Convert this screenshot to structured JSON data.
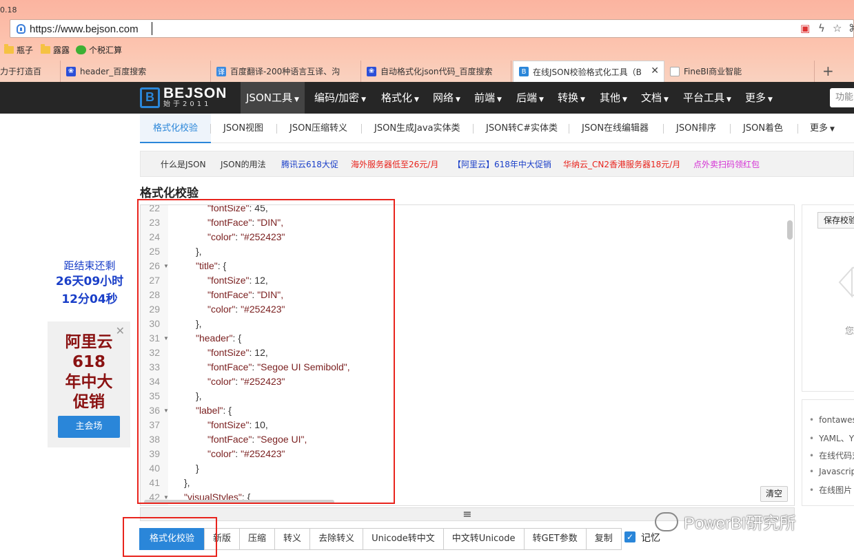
{
  "browser": {
    "version_fragment": "0.18",
    "url": "https://www.bejson.com",
    "bookmarks": [
      "瓶子",
      "露露",
      "个税汇算"
    ],
    "tabs": [
      {
        "label": "力于打造百",
        "active": false
      },
      {
        "label": "header_百度搜索",
        "active": false
      },
      {
        "label": "百度翻译-200种语言互译、沟",
        "active": false
      },
      {
        "label": "自动格式化json代码_百度搜索",
        "active": false
      },
      {
        "label": "在线JSON校验格式化工具（B",
        "active": true
      },
      {
        "label": "FineBI商业智能",
        "active": false
      }
    ],
    "tab_close": "✕",
    "new_tab": "+"
  },
  "site": {
    "logo_text": "BEJSON",
    "logo_sub": "始于2011",
    "logo_mark": "B",
    "nav": [
      {
        "label": "JSON工具",
        "active": true
      },
      {
        "label": "编码/加密"
      },
      {
        "label": "格式化"
      },
      {
        "label": "网络"
      },
      {
        "label": "前端"
      },
      {
        "label": "后端"
      },
      {
        "label": "转换"
      },
      {
        "label": "其他"
      },
      {
        "label": "文档"
      },
      {
        "label": "平台工具"
      },
      {
        "label": "更多"
      }
    ],
    "func_placeholder": "功能",
    "subnav": [
      "格式化校验",
      "JSON视图",
      "JSON压缩转义",
      "JSON生成Java实体类",
      "JSON转C#实体类",
      "JSON在线编辑器",
      "JSON排序",
      "JSON着色",
      "更多"
    ],
    "links": [
      {
        "label": "什么是JSON",
        "color": "#333333"
      },
      {
        "label": "JSON的用法",
        "color": "#333333"
      },
      {
        "label": "腾讯云618大促",
        "color": "#1a3fc8"
      },
      {
        "label": "海外服务器低至26元/月",
        "color": "#e8231c"
      },
      {
        "label": "【阿里云】618年中大促销",
        "color": "#1a3fc8"
      },
      {
        "label": "华纳云_CN2香港服务器18元/月",
        "color": "#e8231c"
      },
      {
        "label": "点外卖扫码领红包",
        "color": "#d42fd4"
      }
    ],
    "page_title": "格式化校验"
  },
  "editor": {
    "lines": [
      {
        "n": "22",
        "fold": false,
        "indent": 3,
        "key": "\"fontSize\"",
        "rest": ": 45,",
        "value": ""
      },
      {
        "n": "23",
        "fold": false,
        "indent": 3,
        "key": "\"fontFace\"",
        "rest": ": ",
        "value": "\"DIN\","
      },
      {
        "n": "24",
        "fold": false,
        "indent": 3,
        "key": "\"color\"",
        "rest": ": ",
        "value": "\"#252423\""
      },
      {
        "n": "25",
        "fold": false,
        "indent": 2,
        "key": "",
        "rest": "},",
        "value": ""
      },
      {
        "n": "26",
        "fold": true,
        "indent": 2,
        "key": "\"title\"",
        "rest": ": {",
        "value": ""
      },
      {
        "n": "27",
        "fold": false,
        "indent": 3,
        "key": "\"fontSize\"",
        "rest": ": 12,",
        "value": ""
      },
      {
        "n": "28",
        "fold": false,
        "indent": 3,
        "key": "\"fontFace\"",
        "rest": ": ",
        "value": "\"DIN\","
      },
      {
        "n": "29",
        "fold": false,
        "indent": 3,
        "key": "\"color\"",
        "rest": ": ",
        "value": "\"#252423\""
      },
      {
        "n": "30",
        "fold": false,
        "indent": 2,
        "key": "",
        "rest": "},",
        "value": ""
      },
      {
        "n": "31",
        "fold": true,
        "indent": 2,
        "key": "\"header\"",
        "rest": ": {",
        "value": ""
      },
      {
        "n": "32",
        "fold": false,
        "indent": 3,
        "key": "\"fontSize\"",
        "rest": ": 12,",
        "value": ""
      },
      {
        "n": "33",
        "fold": false,
        "indent": 3,
        "key": "\"fontFace\"",
        "rest": ": ",
        "value": "\"Segoe UI Semibold\","
      },
      {
        "n": "34",
        "fold": false,
        "indent": 3,
        "key": "\"color\"",
        "rest": ": ",
        "value": "\"#252423\""
      },
      {
        "n": "35",
        "fold": false,
        "indent": 2,
        "key": "",
        "rest": "},",
        "value": ""
      },
      {
        "n": "36",
        "fold": true,
        "indent": 2,
        "key": "\"label\"",
        "rest": ": {",
        "value": ""
      },
      {
        "n": "37",
        "fold": false,
        "indent": 3,
        "key": "\"fontSize\"",
        "rest": ": 10,",
        "value": ""
      },
      {
        "n": "38",
        "fold": false,
        "indent": 3,
        "key": "\"fontFace\"",
        "rest": ": ",
        "value": "\"Segoe UI\","
      },
      {
        "n": "39",
        "fold": false,
        "indent": 3,
        "key": "\"color\"",
        "rest": ": ",
        "value": "\"#252423\""
      },
      {
        "n": "40",
        "fold": false,
        "indent": 2,
        "key": "",
        "rest": "}",
        "value": ""
      },
      {
        "n": "41",
        "fold": false,
        "indent": 1,
        "key": "",
        "rest": "},",
        "value": ""
      },
      {
        "n": "42",
        "fold": true,
        "indent": 1,
        "key": "\"visualStyles\"",
        "rest": ": {",
        "value": ""
      }
    ],
    "clear_label": "清空",
    "resize_glyph": "≡"
  },
  "buttons": [
    "格式化校验",
    "新版",
    "压缩",
    "转义",
    "去除转义",
    "Unicode转中文",
    "中文转Unicode",
    "转GET参数",
    "复制"
  ],
  "remember": {
    "label": "记忆",
    "checked": true
  },
  "countdown": {
    "line1": "距结束还剩",
    "line2": "26天09小时",
    "line3": "12分04秒"
  },
  "ad": {
    "line1": "阿里云",
    "line2": "618",
    "line3": "年中大",
    "line4": "促销",
    "button": "主会场",
    "close": "✕"
  },
  "right_panel": {
    "save_label": "保存校验",
    "empty_text": "您还",
    "list": [
      "fontawes",
      "YAML、Y",
      "在线代码对",
      "Javascript",
      "在线图片"
    ]
  },
  "watermark": "PowerBI研究所",
  "colors": {
    "accent": "#2a86d9",
    "annotation_red": "#e8231c",
    "json_key": "#7a1f1f",
    "nav_bg": "#262626"
  }
}
